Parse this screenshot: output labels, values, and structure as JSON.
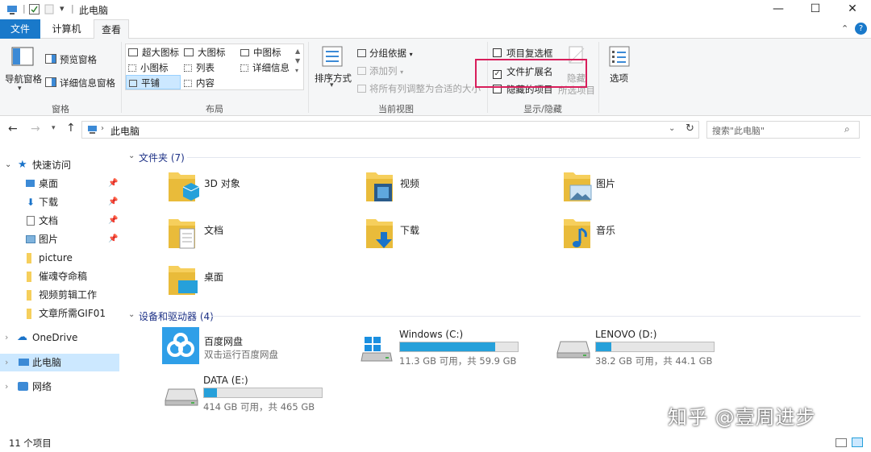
{
  "window": {
    "title": "此电脑"
  },
  "tabs": [
    {
      "label": "文件"
    },
    {
      "label": "计算机"
    },
    {
      "label": "查看"
    }
  ],
  "ribbon": {
    "pane_group": {
      "label": "窗格",
      "nav_pane": "导航窗格",
      "preview_pane": "预览窗格",
      "details_pane": "详细信息窗格"
    },
    "layout_group": {
      "label": "布局",
      "options": [
        "超大图标",
        "大图标",
        "中图标",
        "小图标",
        "列表",
        "详细信息",
        "平铺",
        "内容"
      ],
      "selected": "平铺"
    },
    "current_view": {
      "label": "当前视图",
      "sort_by": "排序方式",
      "group_by": "分组依据",
      "add_column": "添加列",
      "fit_columns": "将所有列调整为合适的大小"
    },
    "show_hide": {
      "label": "显示/隐藏",
      "item_checkboxes": "项目复选框",
      "file_extensions": "文件扩展名",
      "hidden_items": "隐藏的项目",
      "hide_selected": "隐藏",
      "hide_selected_2": "所选项目",
      "item_checkboxes_checked": false,
      "file_extensions_checked": true,
      "hidden_items_checked": false
    },
    "options": "选项"
  },
  "address": {
    "path": "此电脑",
    "search_placeholder": "搜索\"此电脑\""
  },
  "nav": {
    "quick_access": "快速访问",
    "pinned": [
      {
        "label": "桌面"
      },
      {
        "label": "下载"
      },
      {
        "label": "文档"
      },
      {
        "label": "图片"
      }
    ],
    "folders": [
      {
        "label": "picture"
      },
      {
        "label": "催魂夺命稿"
      },
      {
        "label": "视频剪辑工作"
      },
      {
        "label": "文章所需GIF01"
      }
    ],
    "onedrive": "OneDrive",
    "this_pc": "此电脑",
    "network": "网络"
  },
  "content": {
    "folders_header": "文件夹 (7)",
    "folders": [
      {
        "name": "3D 对象"
      },
      {
        "name": "视频"
      },
      {
        "name": "图片"
      },
      {
        "name": "文档"
      },
      {
        "name": "下载"
      },
      {
        "name": "音乐"
      },
      {
        "name": "桌面"
      }
    ],
    "devices_header": "设备和驱动器 (4)",
    "baidu": {
      "name": "百度网盘",
      "sub": "双击运行百度网盘"
    },
    "drives": [
      {
        "name": "Windows (C:)",
        "sub": "11.3 GB 可用，共 59.9 GB",
        "used_fraction": 0.81
      },
      {
        "name": "LENOVO (D:)",
        "sub": "38.2 GB 可用，共 44.1 GB",
        "used_fraction": 0.13
      },
      {
        "name": "DATA (E:)",
        "sub": "414 GB 可用，共 465 GB",
        "used_fraction": 0.11
      }
    ]
  },
  "status": {
    "count": "11 个项目"
  },
  "watermark": "知乎 @壹周进步",
  "colors": {
    "accent": "#1979ca",
    "highlight_box": "#d81e5b",
    "selection": "#cce8ff",
    "drive_bar": "#26a0da"
  }
}
